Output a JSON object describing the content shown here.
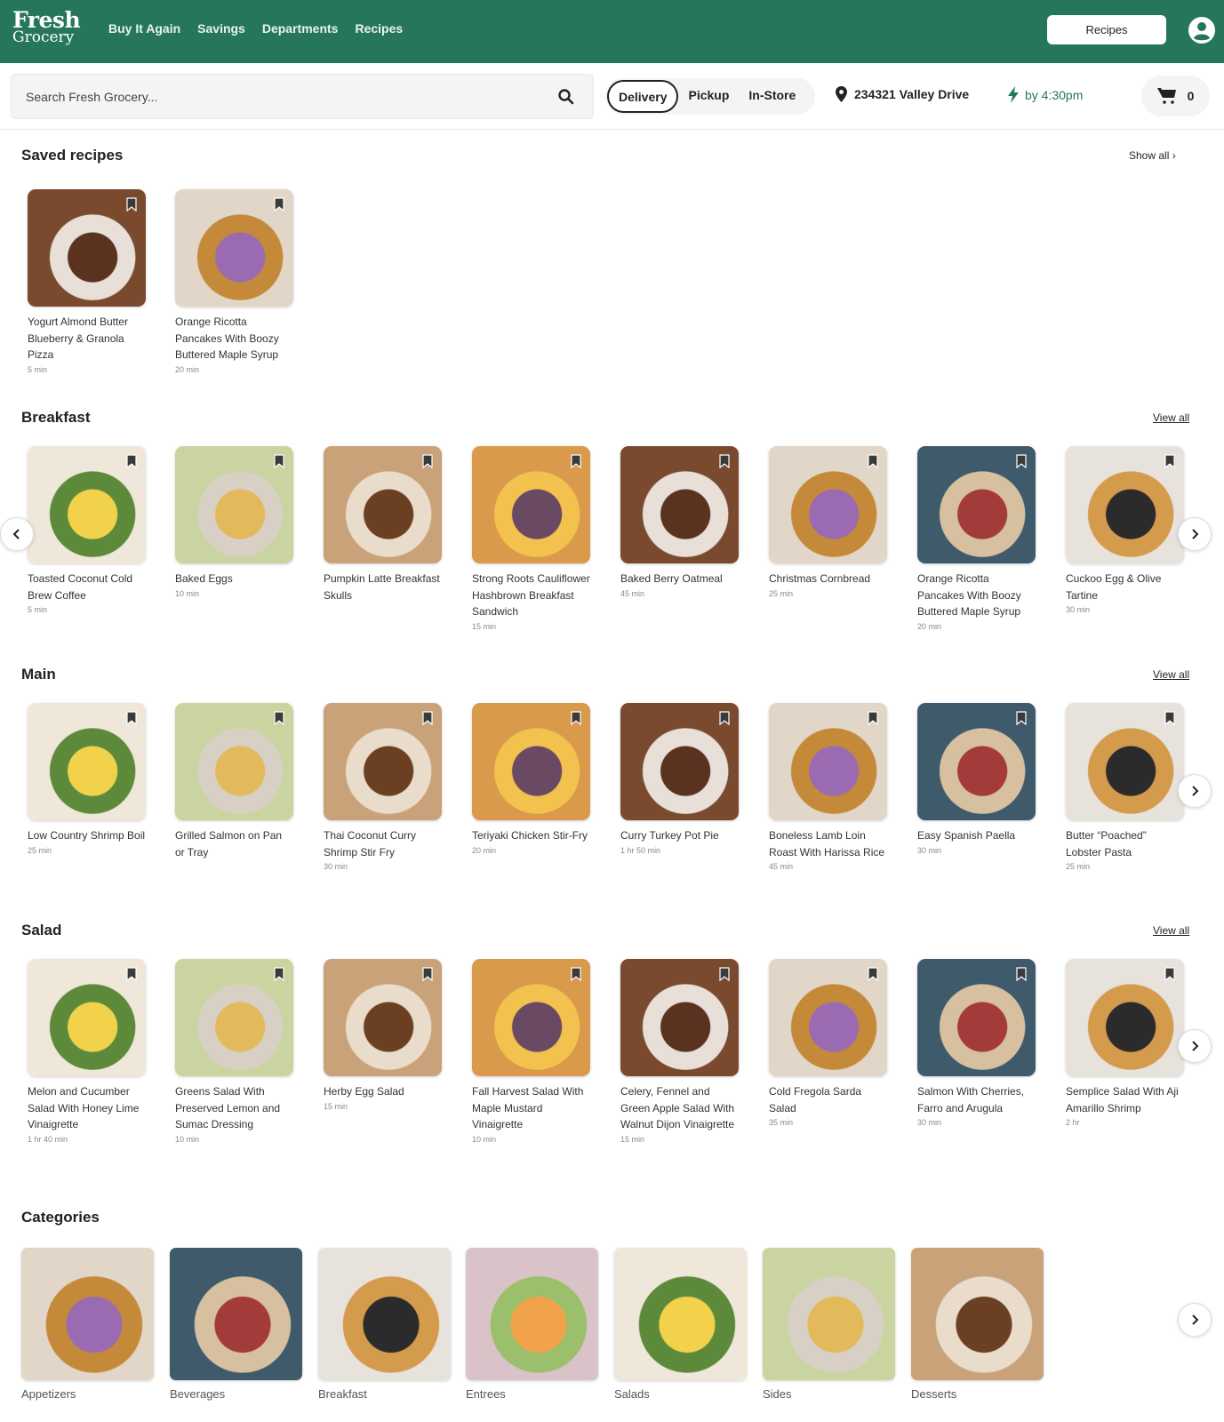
{
  "header": {
    "logo_line1": "Fresh",
    "logo_line2": "Grocery",
    "nav": [
      "Buy It Again",
      "Savings",
      "Departments",
      "Recipes"
    ],
    "recipes_button": "Recipes",
    "brand_color": "#26775a"
  },
  "search": {
    "placeholder": "Search Fresh Grocery...",
    "value": ""
  },
  "fulfillment": {
    "modes": [
      "Delivery",
      "Pickup",
      "In-Store"
    ],
    "selected": "Delivery",
    "address": "234321 Valley Drive",
    "eta": "by 4:30pm",
    "cart_count": "0"
  },
  "saved": {
    "title": "Saved recipes",
    "show_all": "Show all ›",
    "items": [
      {
        "title": "Yogurt Almond Butter Blueberry & Granola Pizza",
        "time": "5 min"
      },
      {
        "title": "Orange Ricotta Pancakes With Boozy Buttered Maple Syrup",
        "time": "20 min"
      }
    ]
  },
  "sections": [
    {
      "title": "Breakfast",
      "view_all": "View all",
      "items": [
        {
          "title": "Toasted Coconut Cold Brew Coffee",
          "time": "5 min"
        },
        {
          "title": "Baked Eggs",
          "time": "10 min"
        },
        {
          "title": "Pumpkin Latte Breakfast Skulls",
          "time": ""
        },
        {
          "title": "Strong Roots Cauliflower Hashbrown Breakfast Sandwich",
          "time": "15 min"
        },
        {
          "title": "Baked Berry Oatmeal",
          "time": "45 min"
        },
        {
          "title": "Christmas Cornbread",
          "time": "25 min"
        },
        {
          "title": "Orange Ricotta Pancakes With Boozy Buttered Maple Syrup",
          "time": "20 min"
        },
        {
          "title": "Cuckoo Egg & Olive Tartine",
          "time": "30 min"
        }
      ]
    },
    {
      "title": "Main",
      "view_all": "View all",
      "items": [
        {
          "title": "Low Country Shrimp Boil",
          "time": "25 min"
        },
        {
          "title": "Grilled Salmon on Pan or Tray",
          "time": ""
        },
        {
          "title": "Thai Coconut Curry Shrimp Stir Fry",
          "time": "30 min"
        },
        {
          "title": "Teriyaki Chicken Stir-Fry",
          "time": "20 min"
        },
        {
          "title": "Curry Turkey Pot Pie",
          "time": "1 hr 50 min"
        },
        {
          "title": "Boneless Lamb Loin Roast With Harissa Rice",
          "time": "45 min"
        },
        {
          "title": "Easy Spanish Paella",
          "time": "30 min"
        },
        {
          "title": "Butter “Poached” Lobster Pasta",
          "time": "25 min"
        }
      ]
    },
    {
      "title": "Salad",
      "view_all": "View all",
      "items": [
        {
          "title": "Melon and Cucumber Salad With Honey Lime Vinaigrette",
          "time": "1 hr 40 min"
        },
        {
          "title": "Greens Salad With Preserved Lemon and Sumac Dressing",
          "time": "10 min"
        },
        {
          "title": "Herby Egg Salad",
          "time": "15 min"
        },
        {
          "title": "Fall Harvest Salad With Maple Mustard Vinaigrette",
          "time": "10 min"
        },
        {
          "title": "Celery, Fennel and Green Apple Salad With Walnut Dijon Vinaigrette",
          "time": "15 min"
        },
        {
          "title": "Cold Fregola Sarda Salad",
          "time": "35 min"
        },
        {
          "title": "Salmon With Cherries, Farro and Arugula",
          "time": "30 min"
        },
        {
          "title": "Semplice Salad With Aji Amarillo Shrimp",
          "time": "2 hr"
        }
      ]
    }
  ],
  "categories": {
    "title": "Categories",
    "items": [
      "Appetizers",
      "Beverages",
      "Breakfast",
      "Entrees",
      "Salads",
      "Sides",
      "Desserts"
    ]
  },
  "icons": {
    "search": "search-icon",
    "location": "map-pin-icon",
    "eta": "lightning-bolt-icon",
    "cart": "shopping-cart-icon",
    "account": "user-circle-icon",
    "bookmark": "bookmark-icon",
    "prev": "chevron-left-icon",
    "next": "chevron-right-icon"
  }
}
